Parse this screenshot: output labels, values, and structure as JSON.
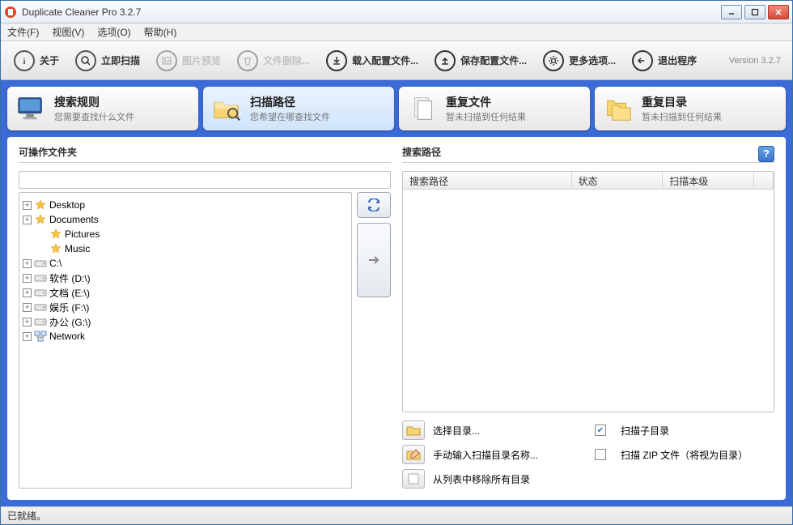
{
  "window": {
    "title": "Duplicate Cleaner Pro 3.2.7"
  },
  "menu": {
    "file": "文件(F)",
    "view": "视图(V)",
    "options": "选项(O)",
    "help": "帮助(H)"
  },
  "toolbar": {
    "about": "关于",
    "scan_now": "立即扫描",
    "image_preview": "图片预览",
    "file_delete": "文件删除...",
    "load_profile": "载入配置文件...",
    "save_profile": "保存配置文件...",
    "more_options": "更多选项...",
    "exit": "退出程序",
    "version": "Version 3.2.7"
  },
  "tabs": [
    {
      "title": "搜索规则",
      "sub": "您需要查找什么文件"
    },
    {
      "title": "扫描路径",
      "sub": "您希望在哪查找文件"
    },
    {
      "title": "重复文件",
      "sub": "暂未扫描到任何结果"
    },
    {
      "title": "重复目录",
      "sub": "暂未扫描到任何结果"
    }
  ],
  "left_panel": {
    "title": "可操作文件夹",
    "tree": [
      {
        "expand": "+",
        "star": true,
        "label": "Desktop",
        "indent": 0
      },
      {
        "expand": "+",
        "star": true,
        "label": "Documents",
        "indent": 0
      },
      {
        "expand": "",
        "star": true,
        "label": "Pictures",
        "indent": 1
      },
      {
        "expand": "",
        "star": true,
        "label": "Music",
        "indent": 1
      },
      {
        "expand": "+",
        "star": false,
        "label": "C:\\",
        "indent": 0
      },
      {
        "expand": "+",
        "star": false,
        "label": "软件 (D:\\)",
        "indent": 0
      },
      {
        "expand": "+",
        "star": false,
        "label": "文档 (E:\\)",
        "indent": 0
      },
      {
        "expand": "+",
        "star": false,
        "label": "娱乐 (F:\\)",
        "indent": 0
      },
      {
        "expand": "+",
        "star": false,
        "label": "办公 (G:\\)",
        "indent": 0
      },
      {
        "expand": "+",
        "star": false,
        "label": "Network",
        "indent": 0
      }
    ]
  },
  "right_panel": {
    "title": "搜索路径",
    "columns": {
      "path": "搜索路径",
      "status": "状态",
      "scan_level": "扫描本级"
    },
    "actions": {
      "select_dir": "选择目录...",
      "manual_input": "手动输入扫描目录名称...",
      "remove_all": "从列表中移除所有目录",
      "scan_sub": "扫描子目录",
      "scan_zip": "扫描 ZIP 文件（将视为目录）"
    }
  },
  "status": "已就绪。"
}
